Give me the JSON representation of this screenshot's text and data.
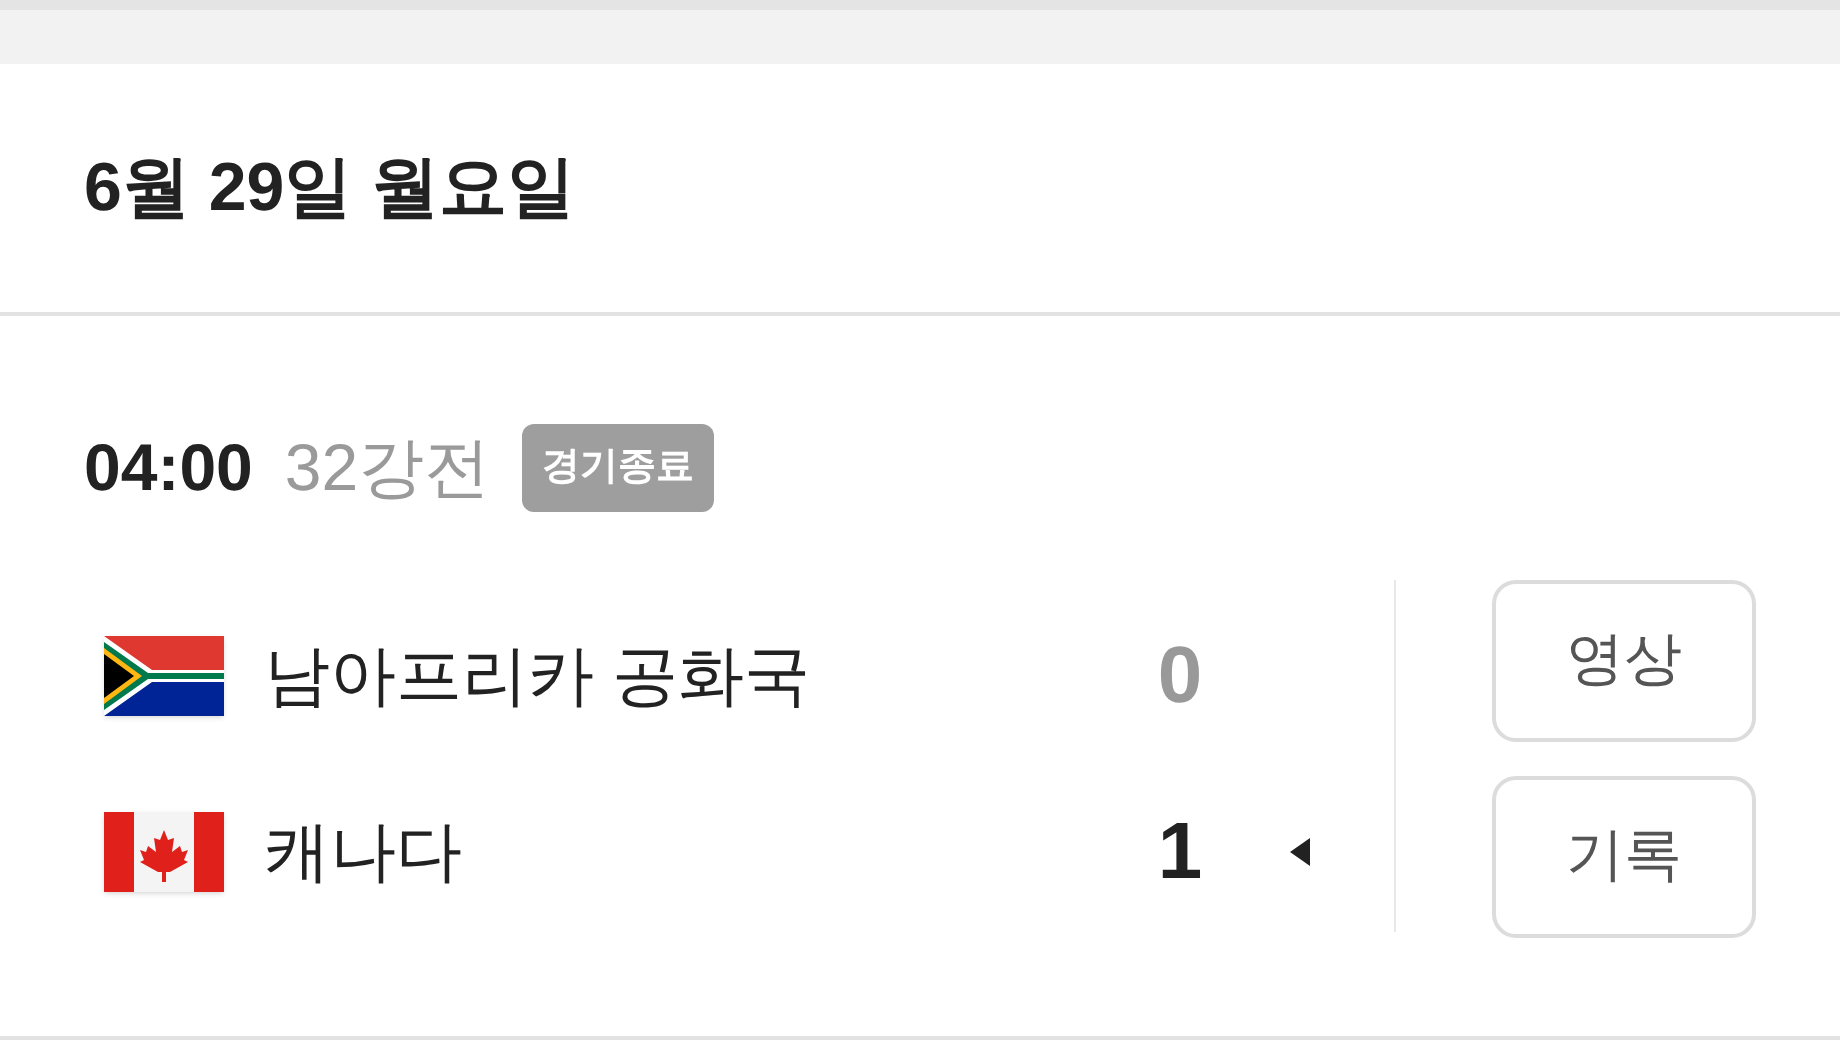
{
  "date_header": "6월 29일 월요일",
  "match": {
    "time": "04:00",
    "round": "32강전",
    "status": "경기종료",
    "teams": [
      {
        "kind": "za",
        "name": "남아프리카 공화국",
        "score": "0",
        "winner": false
      },
      {
        "kind": "ca",
        "name": "캐나다",
        "score": "1",
        "winner": true
      }
    ],
    "buttons": [
      "영상",
      "기록"
    ]
  }
}
